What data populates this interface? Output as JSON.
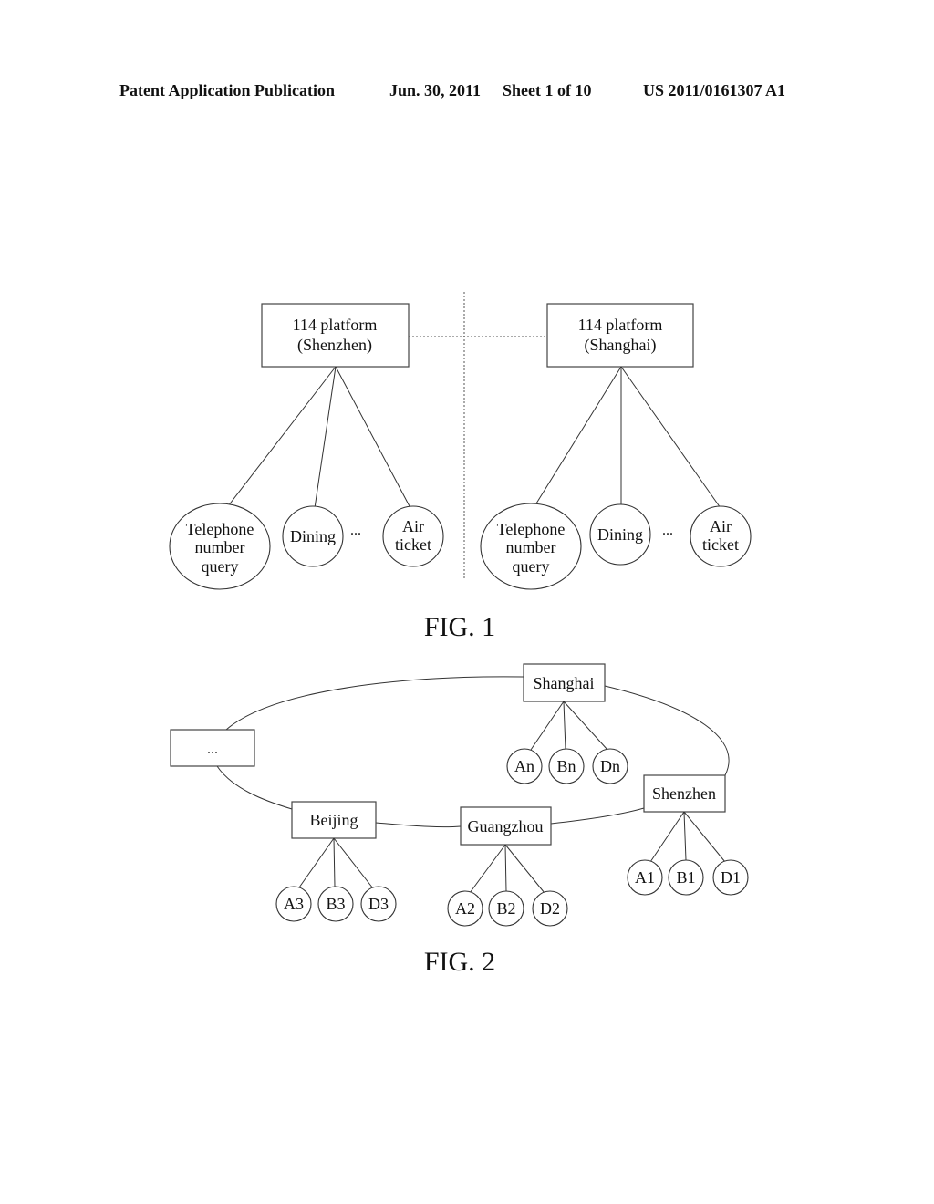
{
  "header": {
    "left": "Patent Application Publication",
    "date": "Jun. 30, 2011",
    "sheet": "Sheet 1 of 10",
    "number": "US 2011/0161307 A1"
  },
  "fig1": {
    "caption": "FIG. 1",
    "left_platform": {
      "line1": "114 platform",
      "line2": "(Shenzhen)"
    },
    "right_platform": {
      "line1": "114 platform",
      "line2": "(Shanghai)"
    },
    "services": {
      "telephone": [
        "Telephone",
        "number",
        "query"
      ],
      "dining": "Dining",
      "air": [
        "Air",
        "ticket"
      ],
      "ellipsis": "..."
    }
  },
  "fig2": {
    "caption": "FIG. 2",
    "ellipsis_node": "...",
    "nodes": {
      "shanghai": {
        "label": "Shanghai",
        "children": [
          "An",
          "Bn",
          "Dn"
        ]
      },
      "shenzhen": {
        "label": "Shenzhen",
        "children": [
          "A1",
          "B1",
          "D1"
        ]
      },
      "guangzhou": {
        "label": "Guangzhou",
        "children": [
          "A2",
          "B2",
          "D2"
        ]
      },
      "beijing": {
        "label": "Beijing",
        "children": [
          "A3",
          "B3",
          "D3"
        ]
      }
    }
  }
}
